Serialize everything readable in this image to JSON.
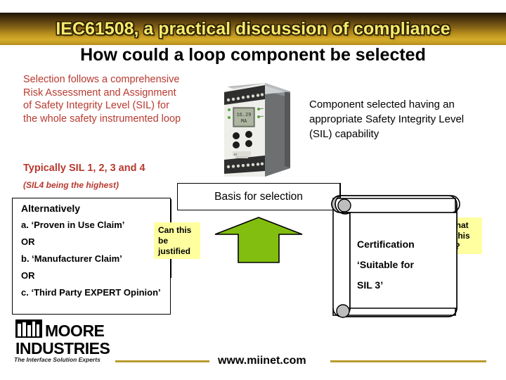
{
  "banner": {
    "title": "IEC61508, a practical discussion of compliance",
    "gradient_top": "#1d1406",
    "gradient_bottom": "#c79f24",
    "text_color": "#f5ea6a"
  },
  "heading": {
    "text": "How could a loop component be selected"
  },
  "left_block": {
    "paragraph": "Selection follows a comprehensive Risk Assessment and Assignment of Safety Integrity Level (SIL) for the whole safety instrumented loop",
    "bold_line": "Typically SIL 1, 2, 3 and 4",
    "italic_line": "(SIL4 being the highest)",
    "color": "#b8392f"
  },
  "right_block": {
    "paragraph": "Component selected having an appropriate Safety Integrity Level (SIL) capability"
  },
  "device": {
    "name": "din-rail-transmitter",
    "lcd_line1": "16.29",
    "lcd_line2": "MA"
  },
  "alternatively_box": {
    "title": "Alternatively",
    "items": [
      "a.   ‘Proven in Use Claim’",
      "OR",
      "b.   ‘Manufacturer Claim’",
      "OR",
      "c.   ‘Third Party EXPERT Opinion’"
    ]
  },
  "basis_box": {
    "label": "Basis for selection"
  },
  "notes": [
    {
      "id": "can-this-be-justified",
      "text": "Can this be justified",
      "color": "#ffffa0"
    },
    {
      "id": "but-what-does-this-mean",
      "text": "But what does this mean?",
      "color": "#ffffa0"
    }
  ],
  "green_arrow": {
    "color": "#82be0f",
    "direction": "up"
  },
  "certificate": {
    "line1": "Certification",
    "line2": "‘Suitable for",
    "line3": "SIL 3’"
  },
  "footer": {
    "brand_line1": "MOORE",
    "brand_line2": "INDUSTRIES",
    "tagline": "The Interface Solution Experts",
    "url": "www.miinet.com",
    "rule_color": "#b99b2e"
  }
}
